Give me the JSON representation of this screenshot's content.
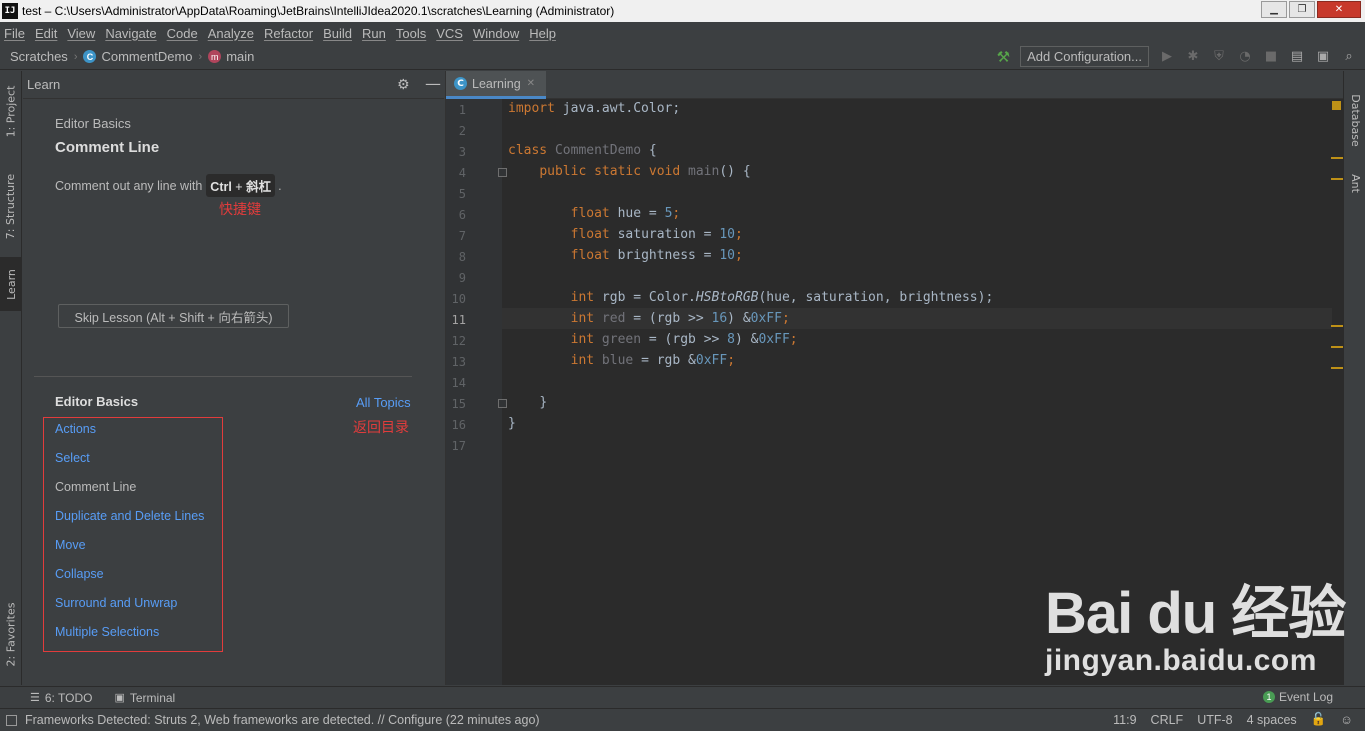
{
  "window": {
    "app_icon": "IJ",
    "title": "test – C:\\Users\\Administrator\\AppData\\Roaming\\JetBrains\\IntelliJIdea2020.1\\scratches\\Learning (Administrator)",
    "controls": [
      "minimize-icon",
      "maximize-icon",
      "close-icon"
    ]
  },
  "menu": [
    "File",
    "Edit",
    "View",
    "Navigate",
    "Code",
    "Analyze",
    "Refactor",
    "Build",
    "Run",
    "Tools",
    "VCS",
    "Window",
    "Help"
  ],
  "breadcrumb": {
    "root": "Scratches",
    "class": "CommentDemo",
    "method": "main"
  },
  "toolbar": {
    "add_configuration": "Add Configuration..."
  },
  "left_tabs": {
    "project": "1: Project",
    "structure": "7: Structure",
    "learn": "Learn",
    "favorites": "2: Favorites"
  },
  "right_tabs": {
    "database": "Database",
    "ant": "Ant"
  },
  "learn_panel": {
    "title": "Learn",
    "lesson_category": "Editor Basics",
    "lesson_title": "Comment Line",
    "instruction_prefix": "Comment out any line with",
    "shortcut_key1": "Ctrl",
    "shortcut_plus": " + ",
    "shortcut_key2": "斜杠",
    "instruction_suffix": ".",
    "annotation_shortcut": "快捷键",
    "skip_button": "Skip Lesson (Alt + Shift + 向右箭头)",
    "toc_heading": "Editor Basics",
    "all_topics": "All Topics",
    "annotation_back": "返回目录",
    "lessons": [
      "Actions",
      "Select",
      "Comment Line",
      "Duplicate and Delete Lines",
      "Move",
      "Collapse",
      "Surround and Unwrap",
      "Multiple Selections"
    ],
    "current_lesson_index": 2
  },
  "editor": {
    "tab_label": "Learning",
    "line_numbers": [
      "1",
      "2",
      "3",
      "4",
      "5",
      "6",
      "7",
      "8",
      "9",
      "10",
      "11",
      "12",
      "13",
      "14",
      "15",
      "16",
      "17"
    ],
    "current_line": "11"
  },
  "code": {
    "l1_kw": "import",
    "l1_rest": " java.awt.Color;",
    "l3_kw": "class",
    "l3_name": " CommentDemo",
    "l3_rest": " {",
    "l4_kw": "public static void",
    "l4_name": " main",
    "l4_rest": "() {",
    "l6_kw": "float",
    "l6_a": " hue = ",
    "l6_n": "5",
    "l6_b": ";",
    "l7_kw": "float",
    "l7_a": " saturation = ",
    "l7_n": "10",
    "l7_b": ";",
    "l8_kw": "float",
    "l8_a": " brightness = ",
    "l8_n": "10",
    "l8_b": ";",
    "l10_kw": "int",
    "l10_a": " rgb = Color.",
    "l10_m": "HSBtoRGB",
    "l10_b": "(hue, saturation, brightness);",
    "l11_kw": "int",
    "l11_v": " red",
    "l11_a": " = (rgb >> ",
    "l11_n": "16",
    "l11_b": ") &",
    "l11_h": "0xFF",
    "l11_c": ";",
    "l12_kw": "int",
    "l12_v": " green",
    "l12_a": " = (rgb >> ",
    "l12_n": "8",
    "l12_b": ") &",
    "l12_h": "0xFF",
    "l12_c": ";",
    "l13_kw": "int",
    "l13_v": " blue",
    "l13_a": " = rgb &",
    "l13_h": "0xFF",
    "l13_c": ";",
    "l15": "}",
    "l16": "}"
  },
  "watermark": {
    "main": "Bai du 经验",
    "sub": "jingyan.baidu.com"
  },
  "bottom_tabs": {
    "todo": "6: TODO",
    "terminal": "Terminal",
    "event_log": "Event Log",
    "event_count": "1"
  },
  "status": {
    "message": "Frameworks Detected: Struts 2, Web frameworks are detected. // Configure (22 minutes ago)",
    "position": "11:9",
    "line_sep": "CRLF",
    "encoding": "UTF-8",
    "indent": "4 spaces"
  },
  "colors": {
    "keyword": "#cc7832",
    "number": "#6897bb",
    "link": "#589df6",
    "annotation": "#e23c3c",
    "warning": "#be9117"
  }
}
